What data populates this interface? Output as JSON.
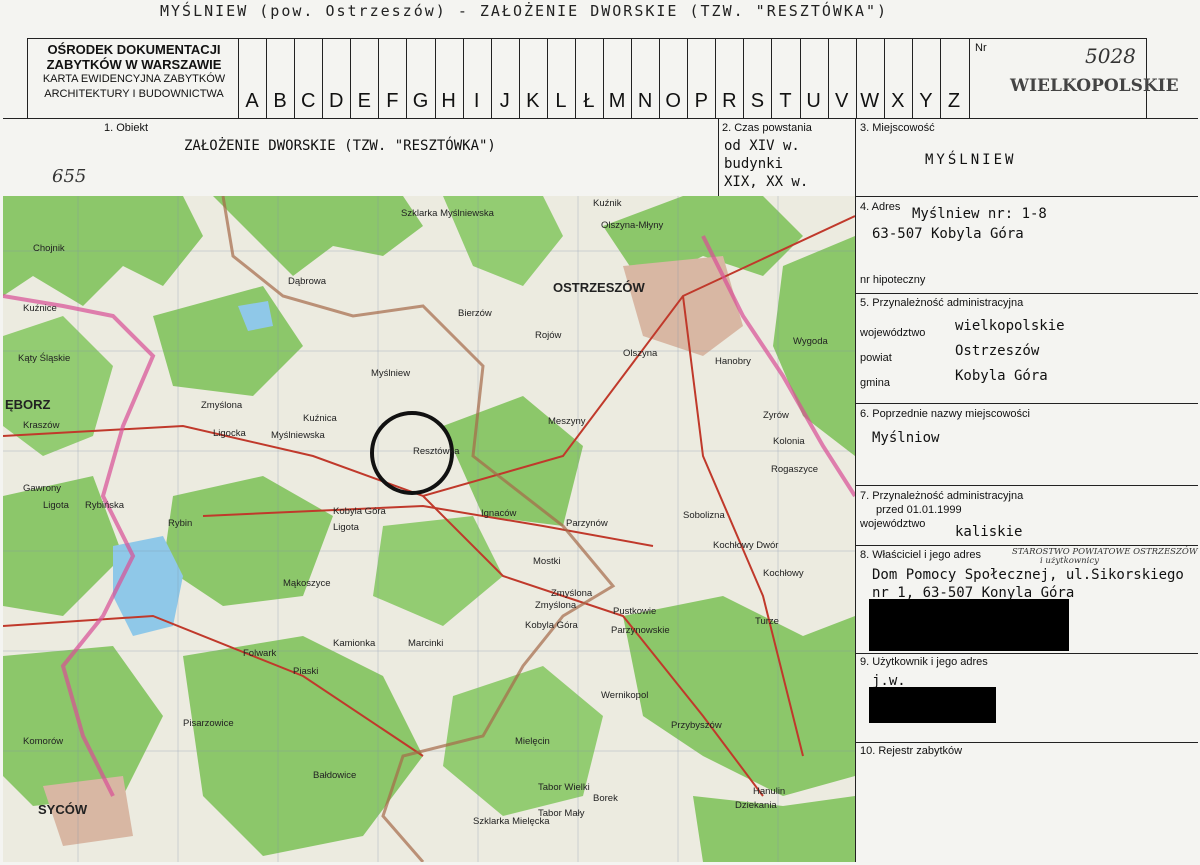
{
  "header": {
    "title": "MYŚLNIEW  (pow. Ostrzeszów) - ZAŁOŻENIE DWORSKIE (TZW. \"RESZTÓWKA\")",
    "org_line1": "OŚRODEK DOKUMENTACJI",
    "org_line2": "ZABYTKÓW W WARSZAWIE",
    "org_line3": "KARTA EWIDENCYJNA ZABYTKÓW",
    "org_line4": "ARCHITEKTURY I BUDOWNICTWA",
    "letters": [
      "A",
      "B",
      "C",
      "D",
      "E",
      "F",
      "G",
      "H",
      "I",
      "J",
      "K",
      "L",
      "Ł",
      "M",
      "N",
      "O",
      "P",
      "R",
      "S",
      "T",
      "U",
      "V",
      "W",
      "X",
      "Y",
      "Z"
    ],
    "nr_label": "Nr",
    "nr_value": "5028",
    "region_stamp": "WIELKOPOLSKIE"
  },
  "fields": {
    "obiekt_label": "1. Obiekt",
    "obiekt_value": "ZAŁOŻENIE DWORSKIE (TZW. \"RESZTÓWKA\")",
    "handwritten_number": "655",
    "czas_label": "2. Czas powstania",
    "czas_line1": "od XIV w.",
    "czas_line2": "budynki",
    "czas_line3": "XIX, XX w.",
    "miejscowosc_label": "3. Miejscowość",
    "miejscowosc_value": "MYŚLNIEW",
    "adres_label": "4. Adres",
    "adres_line1": "Myślniew nr: 1-8",
    "adres_line2": "63-507 Kobyla Góra",
    "hipoteczny_label": "nr hipoteczny",
    "przynaleznosc_label": "5. Przynależność administracyjna",
    "wojewodztwo_label": "województwo",
    "wojewodztwo_value": "wielkopolskie",
    "powiat_label": "powiat",
    "powiat_value": "Ostrzeszów",
    "gmina_label": "gmina",
    "gmina_value": "Kobyla Góra",
    "poprzednie_label": "6. Poprzednie nazwy miejscowości",
    "poprzednie_value": "Myślniow",
    "przynaleznosc_przed_label": "7. Przynależność administracyjna",
    "przed_date": "przed 01.01.1999",
    "wojewodztwo_przed_label": "województwo",
    "wojewodztwo_przed_value": "kaliskie",
    "wlasciciel_label": "8. Właściciel i jego adres",
    "wlasciciel_handwritten1": "STAROSTWO POWIATOWE OSTRZESZÓW",
    "wlasciciel_handwritten2": "i użytkownicy",
    "wlasciciel_line1": "Dom Pomocy Społecznej, ul.Sikorskiego",
    "wlasciciel_line2": "nr 1, 63-507 Konyla Góra",
    "uzytkownik_label": "9. Użytkownik i jego adres",
    "uzytkownik_value": "j.w.",
    "rejestr_label": "10. Rejestr zabytków"
  },
  "map": {
    "place_names": [
      "Szklarka Myślniewska",
      "Kuźnik",
      "Olszyna-Młyny",
      "OSTRZESZÓW",
      "Chojnik",
      "Dąbrowa",
      "Myślniew",
      "Bierzów",
      "Rojów",
      "Olszyna",
      "Hanobry",
      "Zyrów",
      "Kuźnice",
      "Kąty Śląskie",
      "Zmyślona",
      "Kuźnica",
      "Myślniewska",
      "Resztówka",
      "Meszyny",
      "Kolonia",
      "Rogaszyce",
      "ĘBORZ",
      "Kraszów",
      "Ligota",
      "Ligocka",
      "Wygoda",
      "Gawrony",
      "Rybińska",
      "Rybin",
      "Kobyla Góra",
      "Ignaców",
      "Parzynów",
      "Sobolizna",
      "Kochłowy Dwór",
      "Ligota",
      "Mostki",
      "Kochłowy",
      "Mąkoszyce",
      "Zmyślona",
      "Pustkowie",
      "Parzynowskie",
      "Kamionka",
      "Marcinki",
      "Turze",
      "Piaski",
      "Folwark",
      "Pisarzowice",
      "Komorów",
      "Wernikopol",
      "Mielęcin",
      "Przybyszów",
      "SYCÓW",
      "Bałdowice",
      "Tabor Wielki",
      "Tabor Mały",
      "Borek",
      "Szklarka Mielęcka",
      "Dziekania",
      "Hanulin",
      "Zmyślona",
      "Kobyla Góra"
    ]
  }
}
